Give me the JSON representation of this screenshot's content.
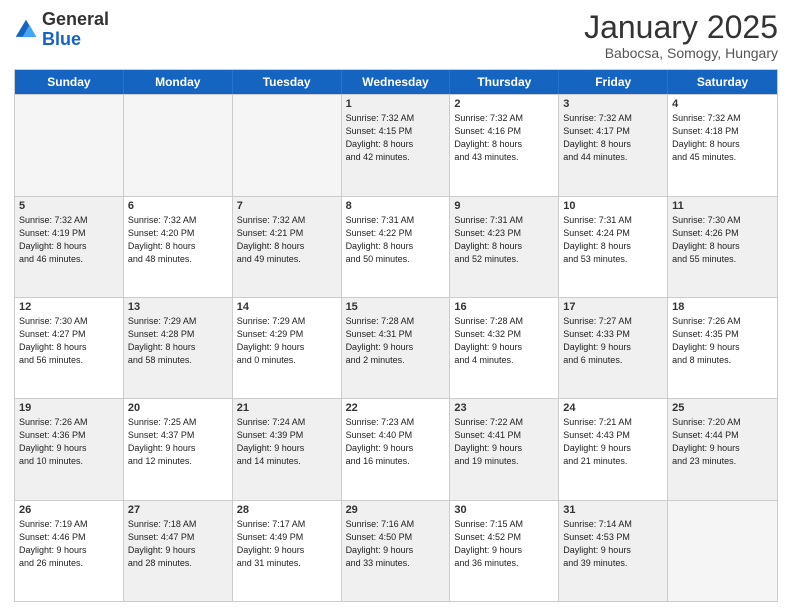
{
  "header": {
    "logo_general": "General",
    "logo_blue": "Blue",
    "title": "January 2025",
    "subtitle": "Babocsa, Somogy, Hungary"
  },
  "weekdays": [
    "Sunday",
    "Monday",
    "Tuesday",
    "Wednesday",
    "Thursday",
    "Friday",
    "Saturday"
  ],
  "rows": [
    [
      {
        "day": "",
        "info": "",
        "empty": true
      },
      {
        "day": "",
        "info": "",
        "empty": true
      },
      {
        "day": "",
        "info": "",
        "empty": true
      },
      {
        "day": "1",
        "info": "Sunrise: 7:32 AM\nSunset: 4:15 PM\nDaylight: 8 hours\nand 42 minutes.",
        "shaded": true
      },
      {
        "day": "2",
        "info": "Sunrise: 7:32 AM\nSunset: 4:16 PM\nDaylight: 8 hours\nand 43 minutes."
      },
      {
        "day": "3",
        "info": "Sunrise: 7:32 AM\nSunset: 4:17 PM\nDaylight: 8 hours\nand 44 minutes.",
        "shaded": true
      },
      {
        "day": "4",
        "info": "Sunrise: 7:32 AM\nSunset: 4:18 PM\nDaylight: 8 hours\nand 45 minutes."
      }
    ],
    [
      {
        "day": "5",
        "info": "Sunrise: 7:32 AM\nSunset: 4:19 PM\nDaylight: 8 hours\nand 46 minutes.",
        "shaded": true
      },
      {
        "day": "6",
        "info": "Sunrise: 7:32 AM\nSunset: 4:20 PM\nDaylight: 8 hours\nand 48 minutes."
      },
      {
        "day": "7",
        "info": "Sunrise: 7:32 AM\nSunset: 4:21 PM\nDaylight: 8 hours\nand 49 minutes.",
        "shaded": true
      },
      {
        "day": "8",
        "info": "Sunrise: 7:31 AM\nSunset: 4:22 PM\nDaylight: 8 hours\nand 50 minutes."
      },
      {
        "day": "9",
        "info": "Sunrise: 7:31 AM\nSunset: 4:23 PM\nDaylight: 8 hours\nand 52 minutes.",
        "shaded": true
      },
      {
        "day": "10",
        "info": "Sunrise: 7:31 AM\nSunset: 4:24 PM\nDaylight: 8 hours\nand 53 minutes."
      },
      {
        "day": "11",
        "info": "Sunrise: 7:30 AM\nSunset: 4:26 PM\nDaylight: 8 hours\nand 55 minutes.",
        "shaded": true
      }
    ],
    [
      {
        "day": "12",
        "info": "Sunrise: 7:30 AM\nSunset: 4:27 PM\nDaylight: 8 hours\nand 56 minutes."
      },
      {
        "day": "13",
        "info": "Sunrise: 7:29 AM\nSunset: 4:28 PM\nDaylight: 8 hours\nand 58 minutes.",
        "shaded": true
      },
      {
        "day": "14",
        "info": "Sunrise: 7:29 AM\nSunset: 4:29 PM\nDaylight: 9 hours\nand 0 minutes."
      },
      {
        "day": "15",
        "info": "Sunrise: 7:28 AM\nSunset: 4:31 PM\nDaylight: 9 hours\nand 2 minutes.",
        "shaded": true
      },
      {
        "day": "16",
        "info": "Sunrise: 7:28 AM\nSunset: 4:32 PM\nDaylight: 9 hours\nand 4 minutes."
      },
      {
        "day": "17",
        "info": "Sunrise: 7:27 AM\nSunset: 4:33 PM\nDaylight: 9 hours\nand 6 minutes.",
        "shaded": true
      },
      {
        "day": "18",
        "info": "Sunrise: 7:26 AM\nSunset: 4:35 PM\nDaylight: 9 hours\nand 8 minutes."
      }
    ],
    [
      {
        "day": "19",
        "info": "Sunrise: 7:26 AM\nSunset: 4:36 PM\nDaylight: 9 hours\nand 10 minutes.",
        "shaded": true
      },
      {
        "day": "20",
        "info": "Sunrise: 7:25 AM\nSunset: 4:37 PM\nDaylight: 9 hours\nand 12 minutes."
      },
      {
        "day": "21",
        "info": "Sunrise: 7:24 AM\nSunset: 4:39 PM\nDaylight: 9 hours\nand 14 minutes.",
        "shaded": true
      },
      {
        "day": "22",
        "info": "Sunrise: 7:23 AM\nSunset: 4:40 PM\nDaylight: 9 hours\nand 16 minutes."
      },
      {
        "day": "23",
        "info": "Sunrise: 7:22 AM\nSunset: 4:41 PM\nDaylight: 9 hours\nand 19 minutes.",
        "shaded": true
      },
      {
        "day": "24",
        "info": "Sunrise: 7:21 AM\nSunset: 4:43 PM\nDaylight: 9 hours\nand 21 minutes."
      },
      {
        "day": "25",
        "info": "Sunrise: 7:20 AM\nSunset: 4:44 PM\nDaylight: 9 hours\nand 23 minutes.",
        "shaded": true
      }
    ],
    [
      {
        "day": "26",
        "info": "Sunrise: 7:19 AM\nSunset: 4:46 PM\nDaylight: 9 hours\nand 26 minutes."
      },
      {
        "day": "27",
        "info": "Sunrise: 7:18 AM\nSunset: 4:47 PM\nDaylight: 9 hours\nand 28 minutes.",
        "shaded": true
      },
      {
        "day": "28",
        "info": "Sunrise: 7:17 AM\nSunset: 4:49 PM\nDaylight: 9 hours\nand 31 minutes."
      },
      {
        "day": "29",
        "info": "Sunrise: 7:16 AM\nSunset: 4:50 PM\nDaylight: 9 hours\nand 33 minutes.",
        "shaded": true
      },
      {
        "day": "30",
        "info": "Sunrise: 7:15 AM\nSunset: 4:52 PM\nDaylight: 9 hours\nand 36 minutes."
      },
      {
        "day": "31",
        "info": "Sunrise: 7:14 AM\nSunset: 4:53 PM\nDaylight: 9 hours\nand 39 minutes.",
        "shaded": true
      },
      {
        "day": "",
        "info": "",
        "empty": true
      }
    ]
  ]
}
